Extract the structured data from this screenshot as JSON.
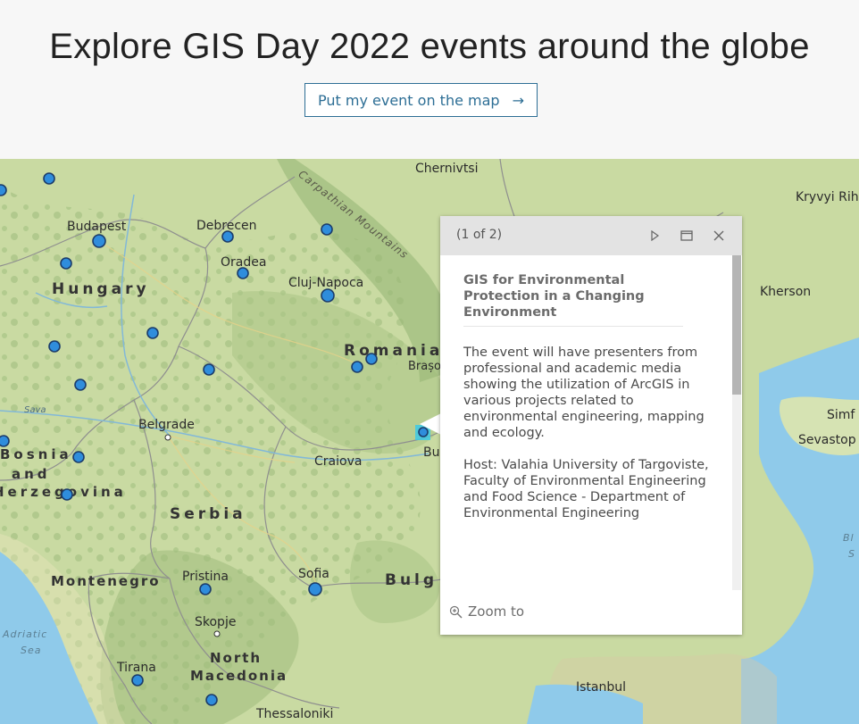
{
  "header": {
    "title": "Explore GIS Day 2022 events around the globe",
    "cta_label": "Put my event on the map",
    "cta_arrow": "→"
  },
  "colors": {
    "accent": "#2d6e95",
    "marker": "#2f8ddc",
    "land": "#c8d9a0",
    "water": "#8fcaea"
  },
  "map": {
    "cities": [
      "Chernivtsi",
      "Budapest",
      "Debrecen",
      "Oradea",
      "Cluj-Napoca",
      "Brașov",
      "Belgrade",
      "Craiova",
      "Bu",
      "Sofia",
      "Skopje",
      "Pristina",
      "Tirana",
      "Thessaloniki",
      "Istanbul",
      "Kherson",
      "Kryvyi Rih",
      "Simf",
      "Sevastop"
    ],
    "countries": [
      "Hungary",
      "Romania",
      "Serbia",
      "Bosnia",
      "and",
      "Herzegovina",
      "Montenegro",
      "North",
      "Macedonia",
      "Bulg"
    ],
    "seas": [
      "Adriatic",
      "Sea",
      "Bl",
      "S"
    ],
    "rivers": [
      "Sava"
    ],
    "mountains": "Carpathian Mountains"
  },
  "popup": {
    "pager": "(1 of 2)",
    "icons": [
      "play-icon",
      "maximize-icon",
      "close-icon"
    ],
    "title": "GIS for Environmental Protection in a Changing Environment",
    "description": "The event will have presenters from professional and academic media showing the utilization of ArcGIS in various projects related to environmental engineering, mapping and ecology.",
    "host": "Host: Valahia University of Targoviste, Faculty of Environmental Engineering and Food Science - Department of Environmental Engineering",
    "zoom_label": "Zoom to"
  }
}
